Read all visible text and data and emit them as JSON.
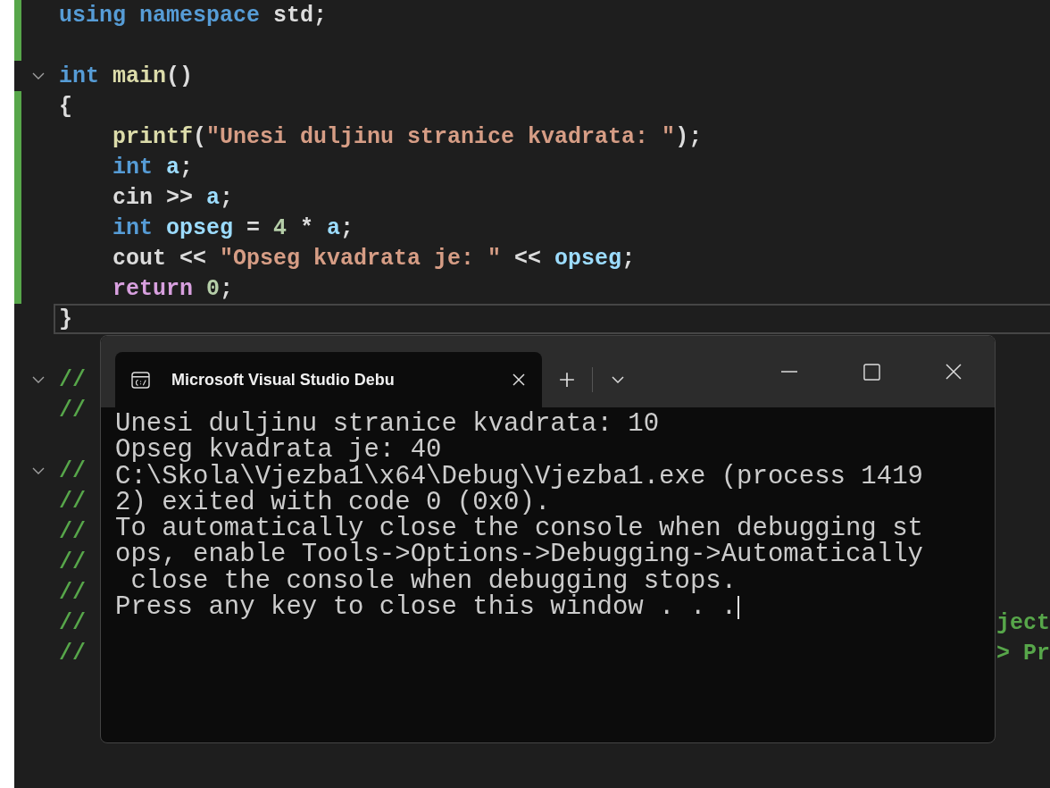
{
  "editor": {
    "lines": [
      {
        "tokens": [
          {
            "text": "using namespace ",
            "kind": "keyword"
          },
          {
            "text": "std;",
            "kind": "plain"
          }
        ],
        "kind": "top",
        "changed": true
      },
      {
        "changed": true
      },
      {
        "tokens": [
          {
            "text": "int ",
            "kind": "keyword"
          },
          {
            "text": "main",
            "kind": "function"
          },
          {
            "text": "()",
            "kind": "plain"
          }
        ],
        "kind": "top",
        "changed": false,
        "expanded": true
      },
      {
        "tokens": [
          {
            "text": "{",
            "kind": "plain"
          }
        ],
        "kind": "top",
        "changed": true
      },
      {
        "tokens": [
          {
            "text": "printf",
            "kind": "function"
          },
          {
            "text": "(",
            "kind": "plain"
          },
          {
            "text": "\"Unesi duljinu stranice kvadrata: \"",
            "kind": "string"
          },
          {
            "text": ");",
            "kind": "plain"
          }
        ],
        "kind": "body",
        "changed": true
      },
      {
        "tokens": [
          {
            "text": "int ",
            "kind": "keyword"
          },
          {
            "text": "a",
            "kind": "variable"
          },
          {
            "text": ";",
            "kind": "plain"
          }
        ],
        "kind": "body",
        "changed": true
      },
      {
        "tokens": [
          {
            "text": "cin >> ",
            "kind": "plain"
          },
          {
            "text": "a",
            "kind": "variable"
          },
          {
            "text": ";",
            "kind": "plain"
          }
        ],
        "kind": "body",
        "changed": true
      },
      {
        "tokens": [
          {
            "text": "int ",
            "kind": "keyword"
          },
          {
            "text": "opseg",
            "kind": "variable"
          },
          {
            "text": " = ",
            "kind": "plain"
          },
          {
            "text": "4",
            "kind": "number"
          },
          {
            "text": " * ",
            "kind": "plain"
          },
          {
            "text": "a",
            "kind": "variable"
          },
          {
            "text": ";",
            "kind": "plain"
          }
        ],
        "kind": "body",
        "changed": true
      },
      {
        "tokens": [
          {
            "text": "cout << ",
            "kind": "plain"
          },
          {
            "text": "\"Opseg kvadrata je: \"",
            "kind": "string"
          },
          {
            "text": " << ",
            "kind": "plain"
          },
          {
            "text": "opseg",
            "kind": "variable"
          },
          {
            "text": ";",
            "kind": "plain"
          }
        ],
        "kind": "body",
        "changed": true
      },
      {
        "tokens": [
          {
            "text": "return ",
            "kind": "control"
          },
          {
            "text": "0",
            "kind": "number"
          },
          {
            "text": ";",
            "kind": "plain"
          }
        ],
        "kind": "body",
        "changed": true
      },
      {
        "tokens": [
          {
            "text": "}",
            "kind": "plain"
          }
        ],
        "kind": "top",
        "changed": false,
        "current": true
      },
      {
        "changed": false
      },
      {
        "tokens": [
          {
            "text": "//",
            "kind": "comment"
          }
        ],
        "kind": "top",
        "changed": false,
        "expanded": true
      },
      {
        "tokens": [
          {
            "text": "//",
            "kind": "comment"
          }
        ],
        "kind": "top",
        "changed": false
      },
      {
        "changed": false
      },
      {
        "tokens": [
          {
            "text": "//",
            "kind": "comment"
          }
        ],
        "kind": "top",
        "changed": false,
        "expanded": true
      },
      {
        "tokens": [
          {
            "text": "//",
            "kind": "comment"
          }
        ],
        "kind": "top",
        "changed": false
      },
      {
        "tokens": [
          {
            "text": "//",
            "kind": "comment"
          }
        ],
        "kind": "top",
        "changed": false
      },
      {
        "tokens": [
          {
            "text": "//",
            "kind": "comment"
          }
        ],
        "kind": "top",
        "changed": false
      },
      {
        "tokens": [
          {
            "text": "//",
            "kind": "comment"
          }
        ],
        "kind": "top",
        "changed": false
      },
      {
        "tokens": [
          {
            "text": "//",
            "kind": "comment"
          }
        ],
        "kind": "top",
        "changed": false,
        "tail": "ject"
      },
      {
        "tokens": [
          {
            "text": "//",
            "kind": "comment"
          }
        ],
        "kind": "top",
        "changed": false,
        "tail": "> Pr"
      }
    ]
  },
  "console": {
    "tabs": [
      {
        "title": "Microsoft Visual Studio Debu",
        "selected": true
      }
    ],
    "lines": [
      {
        "text": "Unesi duljinu stranice kvadrata: 10"
      },
      {
        "text": "Opseg kvadrata je: 40"
      },
      {
        "text": "C:\\Skola\\Vjezba1\\x64\\Debug\\Vjezba1.exe (process 1419"
      },
      {
        "text": "2) exited with code 0 (0x0)."
      },
      {
        "text": "To automatically close the console when debugging st"
      },
      {
        "text": "ops, enable Tools->Options->Debugging->Automatically"
      },
      {
        "text": " close the console when debugging stops."
      },
      {
        "text": "Press any key to close this window . . .",
        "cursor": true
      }
    ]
  }
}
